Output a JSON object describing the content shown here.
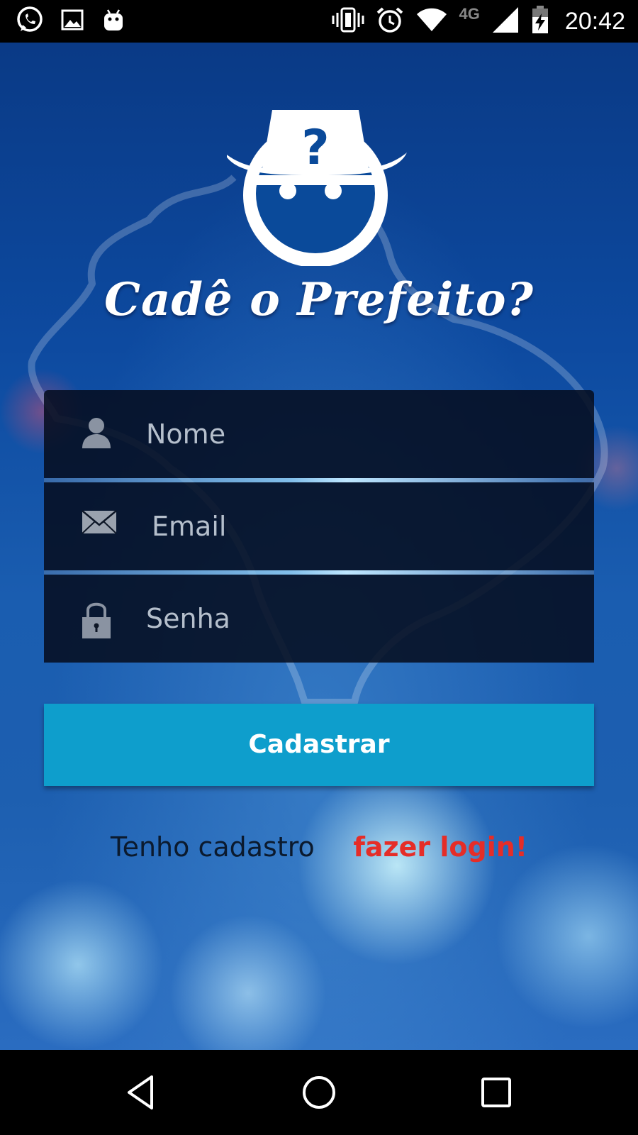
{
  "status_bar": {
    "time": "20:42",
    "network": "4G",
    "left_icons": [
      "whatsapp-icon",
      "image-icon",
      "android-icon"
    ],
    "right_icons": [
      "vibrate-icon",
      "alarm-icon",
      "wifi-icon",
      "signal-icon",
      "battery-charging-icon"
    ]
  },
  "app": {
    "brand": "Cadê o Prefeito?",
    "logo_icon": "detective-face-icon"
  },
  "form": {
    "fields": [
      {
        "icon": "person-icon",
        "placeholder": "Nome"
      },
      {
        "icon": "envelope-icon",
        "placeholder": "Email"
      },
      {
        "icon": "lock-icon",
        "placeholder": "Senha"
      }
    ],
    "submit_label": "Cadastrar"
  },
  "footer": {
    "have_account": "Tenho cadastro",
    "login_link": "fazer login!"
  },
  "nav_bar": {
    "buttons": [
      "back-icon",
      "home-icon",
      "recents-icon"
    ]
  },
  "colors": {
    "accent_button": "#0e9ecc",
    "login_link": "#e52d28",
    "background": "#0d4aa0"
  }
}
